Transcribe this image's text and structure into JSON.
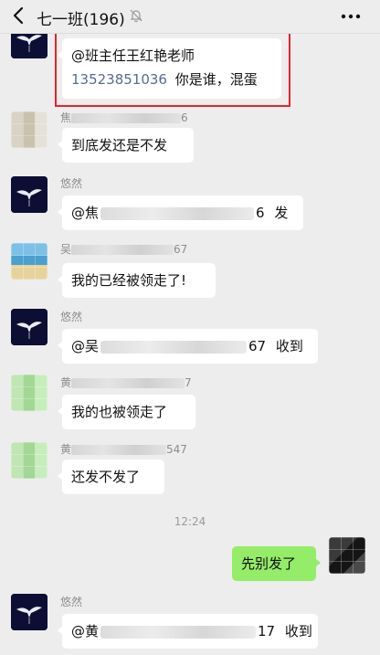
{
  "header": {
    "title": "七一班(196)",
    "back_icon": "chevron-left-icon",
    "mute_icon": "bell-off-icon",
    "more_icon": "more-dots-icon"
  },
  "messages": [
    {
      "sender_name": "",
      "text_prefix": "@班主任王红艳老师",
      "phone": "13523851036",
      "text_suffix": "你是谁，混蛋"
    },
    {
      "sender_name_start": "焦",
      "sender_name_end": "6",
      "text": "到底发还是不发"
    },
    {
      "sender_name": "悠然",
      "text_start": "@焦",
      "text_mid": "6",
      "text_end": "发"
    },
    {
      "sender_name_start": "吴",
      "sender_name_end": "67",
      "text": "我的已经被领走了!"
    },
    {
      "sender_name": "悠然",
      "text_start": "@吴",
      "text_mid": "67",
      "text_end": "收到"
    },
    {
      "sender_name_start": "黄",
      "sender_name_end": "7",
      "text": "我的也被领走了"
    },
    {
      "sender_name_start": "黄",
      "sender_name_end": "547",
      "text": "还发不发了"
    },
    {
      "time": "12:24"
    },
    {
      "self": true,
      "text": "先别发了"
    },
    {
      "sender_name": "悠然",
      "text_start": "@黄",
      "text_mid": "17",
      "text_end": "收到"
    }
  ],
  "colors": {
    "background": "#ededed",
    "bubble_incoming": "#ffffff",
    "bubble_outgoing": "#95ec69",
    "highlight_box": "#e8222a",
    "link_phone": "#576b95"
  }
}
